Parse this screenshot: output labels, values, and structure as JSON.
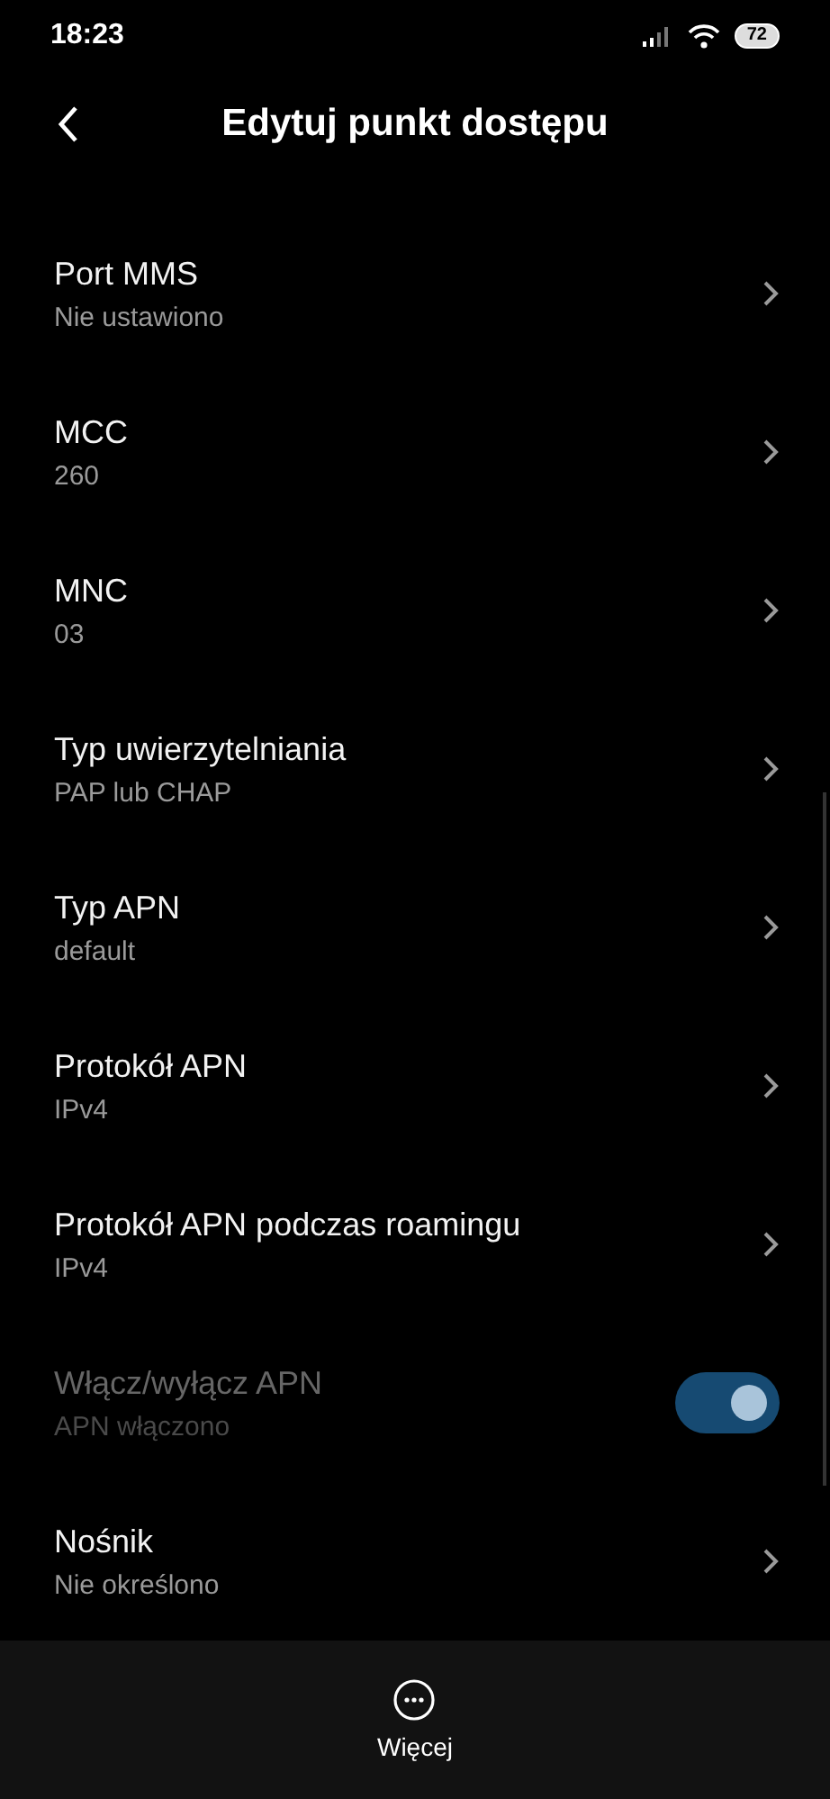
{
  "status_bar": {
    "time": "18:23",
    "battery": "72"
  },
  "header": {
    "title": "Edytuj punkt dostępu"
  },
  "items": [
    {
      "kind": "link",
      "title": "Port MMS",
      "value": "Nie ustawiono"
    },
    {
      "kind": "link",
      "title": "MCC",
      "value": "260"
    },
    {
      "kind": "link",
      "title": "MNC",
      "value": "03"
    },
    {
      "kind": "link",
      "title": "Typ uwierzytelniania",
      "value": "PAP lub CHAP"
    },
    {
      "kind": "link",
      "title": "Typ APN",
      "value": "default"
    },
    {
      "kind": "link",
      "title": "Protokół APN",
      "value": "IPv4"
    },
    {
      "kind": "link",
      "title": "Protokół APN podczas roamingu",
      "value": "IPv4"
    },
    {
      "kind": "toggle",
      "title": "Włącz/wyłącz APN",
      "value": "APN włączono",
      "on": true,
      "disabled": true
    },
    {
      "kind": "link",
      "title": "Nośnik",
      "value": "Nie określono"
    }
  ],
  "bottom_bar": {
    "label": "Więcej"
  }
}
